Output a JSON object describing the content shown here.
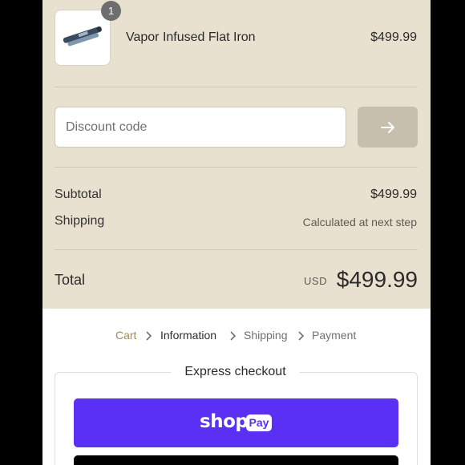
{
  "cart": {
    "item": {
      "name": "Vapor Infused Flat Iron",
      "price": "$499.99",
      "quantity": "1",
      "image_icon": "flat-iron-icon"
    }
  },
  "discount": {
    "placeholder": "Discount code",
    "apply_icon": "arrow-right-icon"
  },
  "summary": {
    "subtotal_label": "Subtotal",
    "subtotal_value": "$499.99",
    "shipping_label": "Shipping",
    "shipping_value": "Calculated at next step",
    "total_label": "Total",
    "total_currency": "USD",
    "total_value": "$499.99"
  },
  "breadcrumb": {
    "items": [
      "Cart",
      "Information",
      "Shipping",
      "Payment"
    ]
  },
  "express": {
    "title": "Express checkout",
    "shop_pay_word": "shop",
    "shop_pay_badge": "Pay"
  },
  "colors": {
    "summary_background": "#e9e1cf",
    "cart_link": "#a08b5c",
    "shop_pay_purple": "#5a31f4",
    "apply_button": "#c7bfae"
  }
}
